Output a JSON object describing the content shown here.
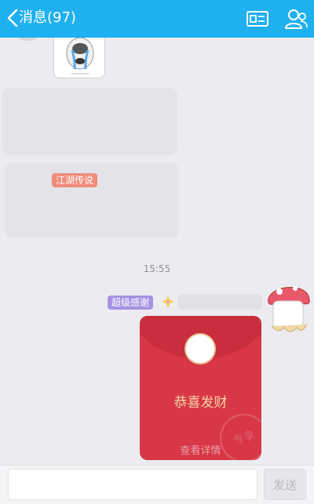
{
  "header": {
    "back_label": "消息(97)",
    "back_icon": "chevron-left-icon",
    "card_icon": "id-card-icon",
    "profile_icon": "profile-icon",
    "bg_color": "#1fb0ef"
  },
  "chat": {
    "bg_color": "#ebebf0",
    "messages": {
      "jianghu_tag": "江湖传说",
      "time": "15:55",
      "chaoji_tag": "超级感谢"
    },
    "red_packet": {
      "title": "恭喜发财",
      "detail": "查看详情",
      "stamp": "专享",
      "color": "#d83747"
    }
  },
  "input_bar": {
    "input_value": "",
    "send_label": "发送"
  }
}
